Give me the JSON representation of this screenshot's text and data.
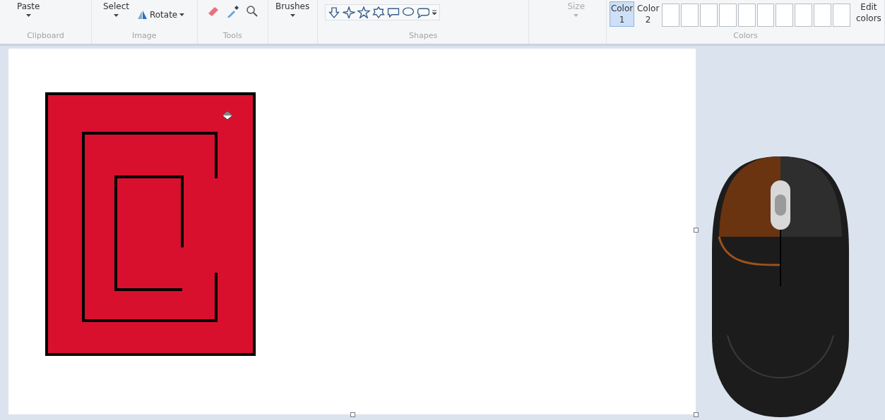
{
  "ribbon": {
    "clipboard": {
      "label": "Clipboard",
      "paste": "Paste"
    },
    "image": {
      "label": "Image",
      "select": "Select",
      "rotate": "Rotate"
    },
    "tools": {
      "label": "Tools"
    },
    "brushes": {
      "label": "Brushes"
    },
    "shapes": {
      "label": "Shapes"
    },
    "size": {
      "label": "Size",
      "disabled": true
    },
    "colors": {
      "label": "Colors",
      "slots": [
        {
          "label": "Color 1",
          "selected": true
        },
        {
          "label": "Color 2",
          "selected": false
        }
      ],
      "edit": "Edit colors"
    }
  },
  "canvas": {
    "kind": "drawing"
  }
}
